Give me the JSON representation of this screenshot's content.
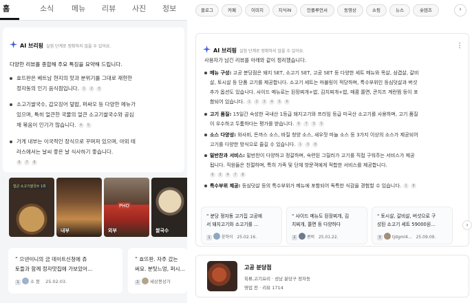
{
  "left": {
    "tabs": [
      "홈",
      "소식",
      "메뉴",
      "리뷰",
      "사진",
      "정보"
    ],
    "ai_title": "AI 브리핑",
    "ai_subtitle": "실험 단계로 정확하지 않을 수 있어요.",
    "intro": "다양한 리뷰를 종합해 주요 특징을 요약해 드립니다.",
    "bullets": [
      {
        "lines": [
          "효뜨판은 베트남 현지의 맛과 분위기를 그대로 재현한",
          "정자동의 인기 음식점입니다."
        ],
        "cites": [
          "1",
          "2",
          "3"
        ]
      },
      {
        "lines": [
          "소고기쌀국수, 갑오징어 덮밥, 퍼싸오 등 다양한 메뉴가",
          "있으며, 특히 얼큰한 국물의 얼큰 소고기쌀국수와 공심",
          "채 볶음이 인기가 많습니다."
        ],
        "cites": [
          "4",
          "5"
        ]
      },
      {
        "lines": [
          "가게 내부는 이국적인 장식으로 꾸며져 있으며, 야외 테",
          "라스에서는 날씨 좋은 날 식사하기 좋습니다."
        ],
        "cites": [
          "6",
          "7",
          "8"
        ]
      }
    ],
    "photos": [
      {
        "label": "",
        "sign": "얼큰 소고기쌀국수 1위"
      },
      {
        "label": "내부",
        "sign": ""
      },
      {
        "label": "외부",
        "sign": "PHO"
      },
      {
        "label": "쌀국수",
        "sign": ""
      }
    ],
    "reviews": [
      {
        "quote_lines": [
          "“ 으넨이니의 금 데이트신청에 쥬",
          "토들과 함께 정자맛집에 가보았어..."
        ],
        "count": "1",
        "author": "소 뭉",
        "date": "25.02.03."
      },
      {
        "quote_lines": [
          "“ 효뜨판. 자주 갔는",
          "써요. 분팃느엉, 퍼시..."
        ],
        "count": "2",
        "author": "세상몽상가",
        "date": ""
      }
    ]
  },
  "right": {
    "chips": [
      "블로그",
      "카페",
      "이미지",
      "지식iN",
      "인플루언서",
      "동영상",
      "쇼핑",
      "뉴스",
      "숏텐츠"
    ],
    "ai_title": "AI 브리핑",
    "ai_subtitle": "실험 단계로 정확하지 않을 수 있어요.",
    "intro": "사용자가 남긴 리뷰를 아래와 같이 정리했습니다.",
    "bullets": [
      {
        "label": "메뉴 구성:",
        "lines": [
          " 고공 분당점은 돼지 SET, 소고기 SET, 고공 SET 등 다양한 세트 메뉴와 목살, 삼겹살, 갈비",
          "살, 토시살 등 단품 고기를 제공합니다. 소고기 세트는 마블링이 적당하며, 특수부위인 등심덧살과 버섯",
          "추가 옵션도 있습니다. 사이드 메뉴로는 된장찌개+밥, 김치찌개+밥, 매콤 쫄면, 콘치즈 계란찜 등이 포",
          "함되어 있습니다."
        ],
        "cites": [
          "1",
          "2",
          "3",
          "4",
          "5",
          "6"
        ]
      },
      {
        "label": "고기 품질:",
        "lines": [
          " 15일간 숙성한 국내산 1등급 돼지고기와 프라임 등급 미국산 소고기를 사용하며, 고기 품질",
          "이 우수하고 두툼하다는 평가를 받습니다."
        ],
        "cites": [
          "6",
          "7",
          "3",
          "5"
        ]
      },
      {
        "label": "소스 다양성:",
        "lines": [
          " 와사비, 돈까스 소스, 바질 청양 소스, 새우젓 마늘 소스 등 3가지 이상의 소스가 제공되어",
          "고기를 다양한 방식으로 즐길 수 있습니다."
        ],
        "cites": [
          "1",
          "3",
          "8"
        ]
      },
      {
        "label": "밑반찬과 서비스:",
        "lines": [
          " 밑반찬이 다양하고 정갈하며, 숙련된 그릴러가 고기를 직접 구워주는 서비스가 제공",
          "됩니다. 직원들은 친절하며, 특히 가족 및 단체 방문객에게 적합한 서비스를 제공합니다."
        ],
        "cites": [
          "6",
          "3",
          "4",
          "7",
          "8"
        ]
      },
      {
        "label": "특수부위 제공:",
        "lines": [
          " 등심덧살 등의 특수부위가 메뉴에 포함되어 독특한 식감을 경험할 수 있습니다."
        ],
        "cites": [
          "1",
          "8"
        ]
      }
    ],
    "reviews": [
      {
        "quote_lines": [
          "“ 분당 정자동 고기집 고공에",
          "서 돼지고기와 소고기를 ..."
        ],
        "count": "1",
        "author": "윤하이",
        "date": "25.02.16."
      },
      {
        "quote_lines": [
          "“ 사이드 메뉴도 된장찌개, 김",
          "치찌개, 쫄면 등 다양하다"
        ],
        "count": "2",
        "author": "콩비",
        "date": "25.01.22."
      },
      {
        "quote_lines": [
          "“ 토시살, 갈비살, 버섯으로 구",
          "성된 소고기 세트 59000원..."
        ],
        "count": "3",
        "author": "tjdgml4...",
        "date": "25.09.09."
      }
    ],
    "place": {
      "name": "고공 분당점",
      "category": "육류,고기요리 · 성남 분당구 정자동",
      "status": "영업 전 · 리뷰 1714"
    }
  },
  "colors": {
    "ai_spark": "#3b5bdb",
    "bg_left": "#f4f5f7"
  }
}
